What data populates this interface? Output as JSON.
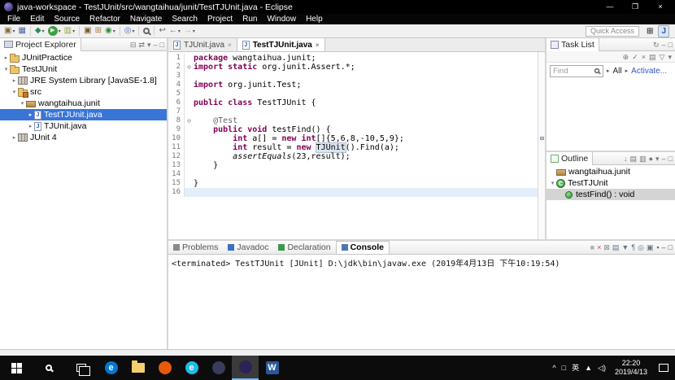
{
  "window": {
    "title": "java-workspace - TestJUnit/src/wangtaihua/junit/TestTJUnit.java - Eclipse",
    "menus": [
      "File",
      "Edit",
      "Source",
      "Refactor",
      "Navigate",
      "Search",
      "Project",
      "Run",
      "Window",
      "Help"
    ],
    "controls": {
      "minimize": "—",
      "maximize": "❐",
      "close": "×"
    }
  },
  "toolbar": {
    "quick_access_label": "Quick Access",
    "icons": [
      {
        "name": "new-wizard-icon",
        "glyph": "▣",
        "color": "#8a6d3b",
        "dropdown": true
      },
      {
        "name": "save-icon",
        "glyph": "▦",
        "color": "#4a5fa5"
      },
      {
        "sep": true
      },
      {
        "name": "debug-icon",
        "glyph": "◆",
        "color": "#2e8b57",
        "dropdown": true
      },
      {
        "name": "run-icon",
        "glyph": "▶",
        "color": "#ffffff",
        "bg": "#3fa03f",
        "dropdown": true
      },
      {
        "name": "coverage-icon",
        "glyph": "▥",
        "color": "#9aa33c",
        "dropdown": true
      },
      {
        "sep": true
      },
      {
        "name": "new-java-project-icon",
        "glyph": "▣",
        "color": "#7d5a2f"
      },
      {
        "name": "new-package-icon",
        "glyph": "⊞",
        "color": "#a5823c"
      },
      {
        "name": "new-class-icon",
        "glyph": "◉",
        "color": "#2f8f2f",
        "dropdown": true
      },
      {
        "sep": true
      },
      {
        "name": "open-task-icon",
        "glyph": "◎",
        "color": "#4a6fb5",
        "dropdown": true
      },
      {
        "sep": true
      },
      {
        "name": "search-icon",
        "mag": true
      },
      {
        "sep": true
      },
      {
        "name": "last-edit-location-icon",
        "glyph": "↩",
        "color": "#666666"
      },
      {
        "name": "back-icon",
        "glyph": "←",
        "color": "#666666",
        "dropdown": true
      },
      {
        "name": "forward-icon",
        "glyph": "→",
        "color": "#aaaaaa",
        "dropdown": true
      }
    ],
    "perspective_icons": [
      {
        "name": "open-perspective-icon",
        "glyph": "⊞",
        "color": "#555555",
        "active": false
      },
      {
        "name": "java-perspective-icon",
        "glyph": "J",
        "color": "#1e62a8",
        "active": true
      }
    ]
  },
  "project_explorer": {
    "title": "Project Explorer",
    "header_icons": [
      {
        "name": "collapse-all-icon",
        "glyph": "⊟"
      },
      {
        "name": "link-with-editor-icon",
        "glyph": "⇄"
      },
      {
        "name": "view-menu-icon",
        "glyph": "▾"
      },
      {
        "name": "minimize-view-icon",
        "glyph": "–"
      },
      {
        "name": "maximize-view-icon",
        "glyph": "□"
      }
    ],
    "items": [
      {
        "label": "JUnitPractice",
        "level": 0,
        "arrow": "collapsed",
        "icon": "project"
      },
      {
        "label": "TestJUnit",
        "level": 0,
        "arrow": "expanded",
        "icon": "project"
      },
      {
        "label": "JRE System Library [JavaSE-1.8]",
        "level": 1,
        "arrow": "collapsed",
        "icon": "library"
      },
      {
        "label": "src",
        "level": 1,
        "arrow": "expanded",
        "icon": "src"
      },
      {
        "label": "wangtaihua.junit",
        "level": 2,
        "arrow": "expanded",
        "icon": "package"
      },
      {
        "label": "TestTJUnit.java",
        "level": 3,
        "arrow": "collapsed",
        "icon": "java-file",
        "selected": true
      },
      {
        "label": "TJUnit.java",
        "level": 3,
        "arrow": "collapsed",
        "icon": "java-file"
      },
      {
        "label": "JUnit 4",
        "level": 1,
        "arrow": "collapsed",
        "icon": "library"
      }
    ]
  },
  "editor": {
    "tabs": [
      {
        "label": "TJUnit.java",
        "active": false
      },
      {
        "label": "TestTJUnit.java",
        "active": true
      }
    ],
    "lines": [
      {
        "n": "1",
        "segs": [
          [
            "kw",
            "package "
          ],
          [
            "pl",
            "wangtaihua.junit;"
          ]
        ]
      },
      {
        "n": "2",
        "fold": true,
        "segs": [
          [
            "kw",
            "import static "
          ],
          [
            "pl",
            "org.junit.Assert.*;"
          ]
        ]
      },
      {
        "n": "3",
        "segs": []
      },
      {
        "n": "4",
        "segs": [
          [
            "kw",
            "import "
          ],
          [
            "pl",
            "org.junit.Test;"
          ]
        ]
      },
      {
        "n": "5",
        "segs": []
      },
      {
        "n": "6",
        "segs": [
          [
            "kw",
            "public class "
          ],
          [
            "pl",
            "TestTJUnit {"
          ]
        ]
      },
      {
        "n": "7",
        "segs": []
      },
      {
        "n": "8",
        "fold": true,
        "segs": [
          [
            "pl",
            "    "
          ],
          [
            "ann",
            "@Test"
          ]
        ]
      },
      {
        "n": "9",
        "segs": [
          [
            "pl",
            "    "
          ],
          [
            "kw",
            "public void "
          ],
          [
            "pl",
            "testFind() {"
          ]
        ]
      },
      {
        "n": "10",
        "segs": [
          [
            "pl",
            "        "
          ],
          [
            "kw",
            "int"
          ],
          [
            "pl",
            " a[] = "
          ],
          [
            "kw",
            "new int"
          ],
          [
            "pl",
            "[]{5,6,8,-10,5,9};"
          ]
        ]
      },
      {
        "n": "11",
        "segs": [
          [
            "pl",
            "        "
          ],
          [
            "kw",
            "int"
          ],
          [
            "pl",
            " result = "
          ],
          [
            "kw",
            "new "
          ],
          [
            "hl",
            "TJUnit"
          ],
          [
            "pl",
            "().Find(a);"
          ]
        ]
      },
      {
        "n": "12",
        "segs": [
          [
            "pl",
            "        "
          ],
          [
            "it",
            "assertEquals"
          ],
          [
            "pl",
            "(23,result);"
          ]
        ]
      },
      {
        "n": "13",
        "segs": [
          [
            "pl",
            "    }"
          ]
        ]
      },
      {
        "n": "14",
        "segs": []
      },
      {
        "n": "15",
        "segs": [
          [
            "pl",
            "}"
          ]
        ]
      },
      {
        "n": "16",
        "current": true,
        "segs": []
      }
    ]
  },
  "task_list": {
    "title": "Task List",
    "header_icons": [
      {
        "name": "refresh-icon",
        "glyph": "↻"
      },
      {
        "name": "minimize-view-icon",
        "glyph": "–"
      },
      {
        "name": "maximize-view-icon",
        "glyph": "□"
      }
    ],
    "toolbar_icons": [
      {
        "name": "new-task-icon",
        "glyph": "⊕"
      },
      {
        "name": "mark-complete-icon",
        "glyph": "✓"
      },
      {
        "name": "delete-task-icon",
        "glyph": "×"
      },
      {
        "name": "categorized-icon",
        "glyph": "▤"
      },
      {
        "name": "filter-icon",
        "glyph": "▽"
      },
      {
        "name": "view-menu-icon",
        "glyph": "▾"
      }
    ],
    "find_placeholder": "Find",
    "all_label": "All",
    "activate_label": "Activate..."
  },
  "outline": {
    "title": "Outline",
    "header_icons": [
      {
        "name": "sort-icon",
        "glyph": "↓"
      },
      {
        "name": "hide-fields-icon",
        "glyph": "▤"
      },
      {
        "name": "hide-static-members-icon",
        "glyph": "▥"
      },
      {
        "name": "hide-non-public-icon",
        "glyph": "●"
      },
      {
        "name": "view-menu-icon",
        "glyph": "▾"
      },
      {
        "name": "minimize-view-icon",
        "glyph": "–"
      },
      {
        "name": "maximize-view-icon",
        "glyph": "□"
      }
    ],
    "items": [
      {
        "label": "wangtaihua.junit",
        "icon": "package",
        "level": 0,
        "arrow": "none"
      },
      {
        "label": "TestTJUnit",
        "icon": "class",
        "level": 0,
        "arrow": "expanded"
      },
      {
        "label": "testFind() : void",
        "icon": "method",
        "level": 1,
        "arrow": "none",
        "selected": true
      }
    ]
  },
  "console": {
    "tabs": [
      {
        "label": "Problems",
        "icon_color": "#8a8a8a",
        "active": false
      },
      {
        "label": "Javadoc",
        "icon_color": "#3a6fc4",
        "active": false
      },
      {
        "label": "Declaration",
        "icon_color": "#3a9a4a",
        "active": false
      },
      {
        "label": "Console",
        "icon_color": "#4a7ab5",
        "active": true
      }
    ],
    "toolbar_icons": [
      {
        "name": "terminate-icon",
        "glyph": "■",
        "color": "#b0b0b0"
      },
      {
        "name": "remove-launch-icon",
        "glyph": "×",
        "color": "#b05050"
      },
      {
        "name": "remove-all-launches-icon",
        "glyph": "⊠",
        "color": "#888888"
      },
      {
        "name": "clear-console-icon",
        "glyph": "▤",
        "color": "#667788"
      },
      {
        "name": "scroll-lock-icon",
        "glyph": "▼",
        "color": "#667788"
      },
      {
        "name": "word-wrap-icon",
        "glyph": "¶",
        "color": "#667788"
      },
      {
        "name": "pin-console-icon",
        "glyph": "◎",
        "color": "#667788"
      },
      {
        "name": "display-console-icon",
        "glyph": "▣",
        "color": "#667788",
        "dropdown": true
      },
      {
        "name": "minimize-view-icon",
        "glyph": "–",
        "color": "#555555"
      },
      {
        "name": "maximize-view-icon",
        "glyph": "□",
        "color": "#555555"
      }
    ],
    "text": "<terminated> TestTJUnit [JUnit] D:\\jdk\\bin\\javaw.exe (2019年4月13日 下午10:19:54)"
  },
  "taskbar": {
    "apps": [
      {
        "name": "taskbar-app-edge",
        "glyph": "e",
        "bg": "#0078d7",
        "shape": "circle"
      },
      {
        "name": "taskbar-app-file-explorer",
        "shape": "folder"
      },
      {
        "name": "taskbar-app-firefox",
        "glyph": "",
        "bg": "#e8590c",
        "shape": "circle"
      },
      {
        "name": "taskbar-app-internet-explorer",
        "glyph": "e",
        "bg": "#1ebbee",
        "shape": "circle"
      },
      {
        "name": "taskbar-app-dark-app",
        "glyph": "",
        "bg": "#3b3b5e",
        "shape": "circle"
      },
      {
        "name": "taskbar-app-eclipse",
        "glyph": "",
        "bg": "#2c2255",
        "shape": "circle",
        "active": true
      },
      {
        "name": "taskbar-app-word",
        "glyph": "W",
        "bg": "#2b579a",
        "shape": "square"
      }
    ],
    "tray_icons": [
      {
        "name": "hidden-icons-chevron",
        "glyph": "^"
      },
      {
        "name": "tray-app-icon",
        "glyph": "□"
      },
      {
        "name": "ime-indicator",
        "glyph": "英"
      },
      {
        "name": "network-icon",
        "glyph": "▲"
      },
      {
        "name": "volume-icon",
        "glyph": "◁)"
      }
    ],
    "time": "22:20",
    "date": "2019/4/13"
  }
}
